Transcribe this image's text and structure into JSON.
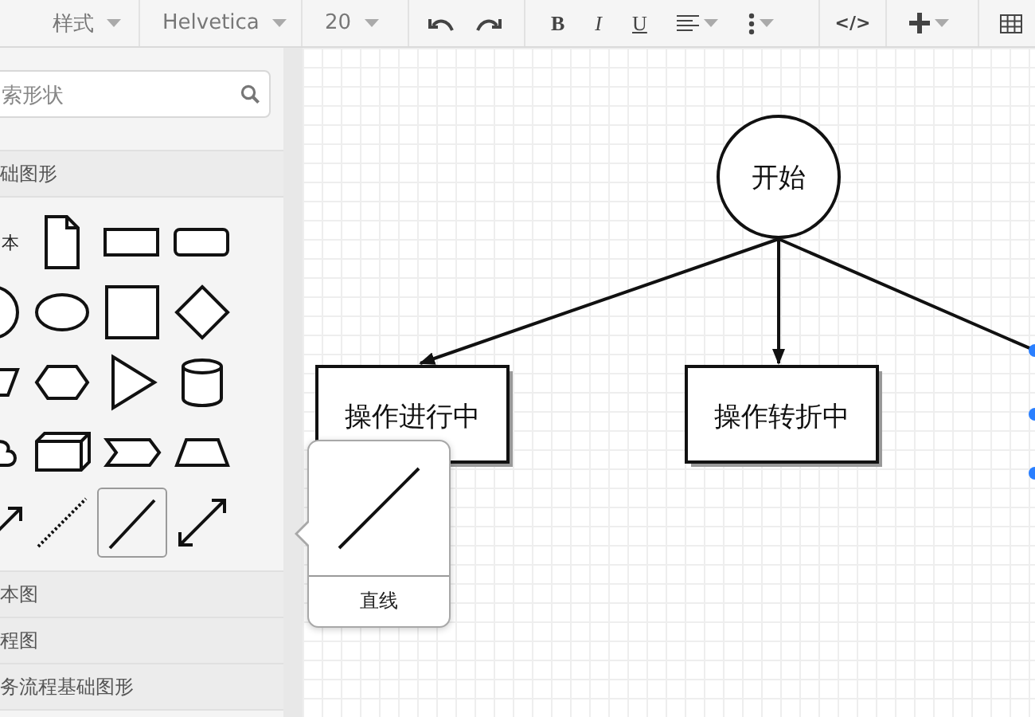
{
  "toolbar": {
    "style_dropdown": "样式",
    "font_dropdown": "Helvetica",
    "size_dropdown": "20",
    "format_buttons": [
      "B",
      "I",
      "U"
    ],
    "code_button": "</>"
  },
  "sidebar": {
    "search": {
      "placeholder": "索形状"
    },
    "sections": [
      "础图形",
      "本图",
      "程图",
      "务流程基础图形"
    ],
    "shapes": [
      {
        "kind": "text",
        "label": "本",
        "selected": false
      },
      {
        "kind": "note",
        "selected": false
      },
      {
        "kind": "rect",
        "selected": false
      },
      {
        "kind": "rounded",
        "selected": false
      },
      {
        "kind": "circle",
        "selected": false
      },
      {
        "kind": "ellipse",
        "selected": false
      },
      {
        "kind": "square",
        "selected": false
      },
      {
        "kind": "diamond",
        "selected": false
      },
      {
        "kind": "parallelogram",
        "selected": false
      },
      {
        "kind": "hexagon",
        "selected": false
      },
      {
        "kind": "triangle",
        "selected": false
      },
      {
        "kind": "cylinder",
        "selected": false
      },
      {
        "kind": "cloud",
        "selected": false
      },
      {
        "kind": "cube",
        "selected": false
      },
      {
        "kind": "step",
        "selected": false
      },
      {
        "kind": "trapezoid",
        "selected": false
      },
      {
        "kind": "arrow",
        "selected": false
      },
      {
        "kind": "dotted",
        "selected": false
      },
      {
        "kind": "line",
        "selected": true
      },
      {
        "kind": "double",
        "selected": false
      }
    ]
  },
  "popover": {
    "label": "直线"
  },
  "diagram": {
    "nodes": [
      {
        "kind": "circle",
        "label": "开始"
      },
      {
        "kind": "rect",
        "label": "操作进行中"
      },
      {
        "kind": "rect",
        "label": "操作转折中"
      }
    ]
  }
}
